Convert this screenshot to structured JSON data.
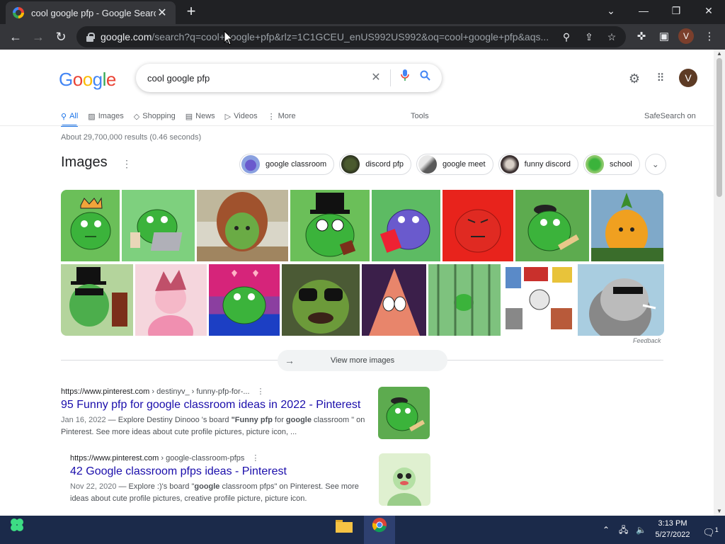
{
  "browser": {
    "tab_title": "cool google pfp - Google Search",
    "url_host": "google.com",
    "url_rest": "/search?q=cool+google+pfp&rlz=1C1GCEU_enUS992US992&oq=cool+google+pfp&aqs...",
    "profile_initial": "V"
  },
  "search": {
    "logo": "Google",
    "query": "cool google pfp",
    "avatar_initial": "V"
  },
  "nav": {
    "tabs": [
      {
        "label": "All",
        "icon": "search-icon"
      },
      {
        "label": "Images",
        "icon": "image-icon"
      },
      {
        "label": "Shopping",
        "icon": "tag-icon"
      },
      {
        "label": "News",
        "icon": "news-icon"
      },
      {
        "label": "Videos",
        "icon": "play-icon"
      },
      {
        "label": "More",
        "icon": "kebab-icon"
      }
    ],
    "tools": "Tools",
    "safesearch": "SafeSearch on"
  },
  "stats": "About 29,700,000 results (0.46 seconds)",
  "images": {
    "heading": "Images",
    "chips": [
      "google classroom",
      "discord pfp",
      "google meet",
      "funny discord",
      "school"
    ],
    "feedback": "Feedback",
    "view_more": "View more images"
  },
  "results": [
    {
      "domain": "https://www.pinterest.com",
      "path": " › destinyv_ › funny-pfp-for-...",
      "title": "95 Funny pfp for google classroom ideas in 2022 - Pinterest",
      "date": "Jan 16, 2022",
      "snippet_a": " — Explore Destiny Dinooo 's board ",
      "snippet_b1": "\"Funny pfp",
      "snippet_c": " for ",
      "snippet_b2": "google",
      "snippet_d": " classroom \" on Pinterest. See more ideas about cute profile pictures, picture icon, ..."
    },
    {
      "domain": "https://www.pinterest.com",
      "path": " › google-classroom-pfps",
      "title": "42 Google classroom pfps ideas - Pinterest",
      "date": "Nov 22, 2020",
      "snippet_a": " — Explore :)'s board \"",
      "snippet_b1": "google",
      "snippet_c": " classroom pfps\" on Pinterest. See more ideas about cute profile pictures, creative profile picture, picture icon.",
      "snippet_b2": "",
      "snippet_d": ""
    }
  ],
  "taskbar": {
    "time": "3:13 PM",
    "date": "5/27/2022",
    "notification_count": "1"
  },
  "colors": {
    "link": "#1a0dab",
    "accent": "#1a73e8",
    "frog_green": "#3bb33b"
  }
}
